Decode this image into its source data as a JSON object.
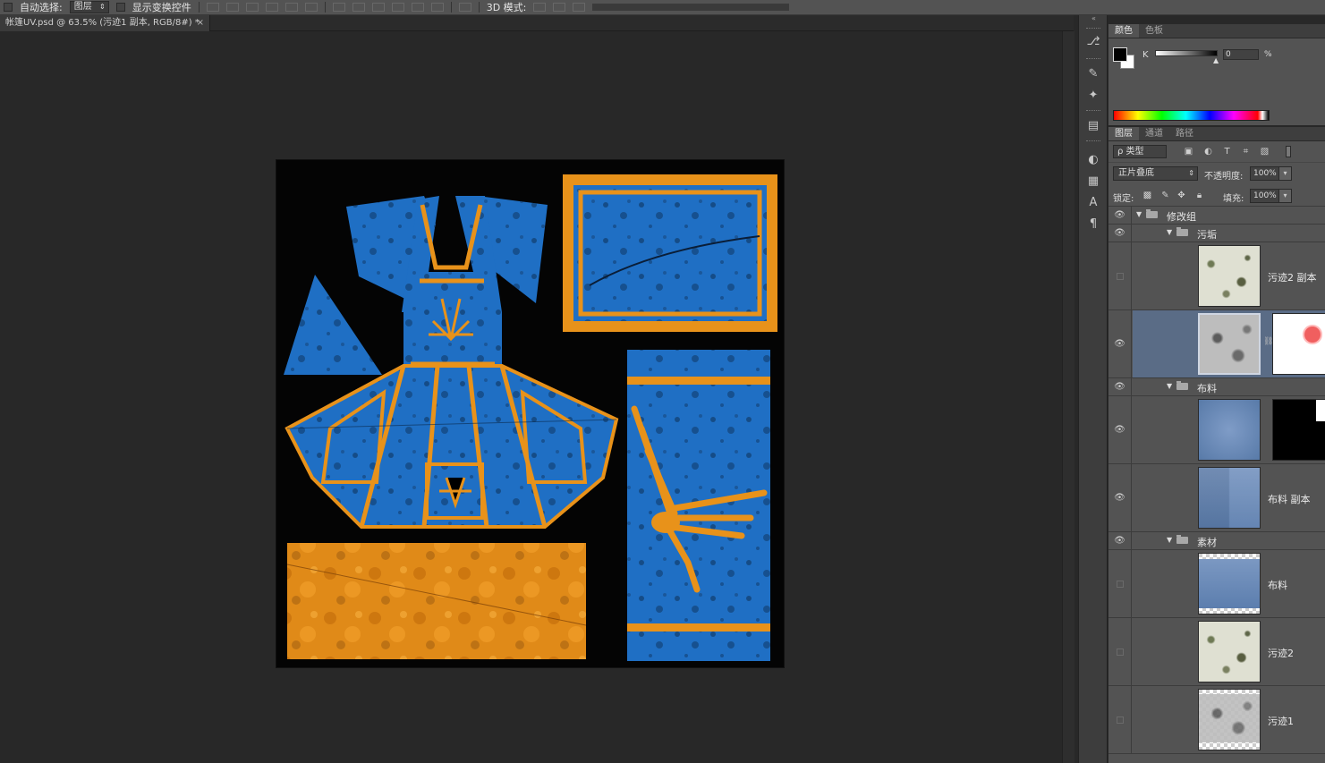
{
  "options_bar": {
    "auto_select_label": "自动选择:",
    "auto_select_value": "图层",
    "show_transform_label": "显示变换控件",
    "mode_3d_label": "3D 模式:"
  },
  "document_tab": {
    "title": "帐篷UV.psd @ 63.5% (污迹1 副本, RGB/8#) *",
    "close": "×"
  },
  "color_panel": {
    "tabs": [
      "颜色",
      "色板"
    ],
    "channel_label": "K",
    "value": "0",
    "unit": "%",
    "foreground": "#000000",
    "background": "#ffffff"
  },
  "layers_panel": {
    "tabs": [
      "图层",
      "通道",
      "路径"
    ],
    "filter_label": "ρ 类型",
    "blend_mode": "正片叠底",
    "opacity_label": "不透明度:",
    "opacity_value": "100%",
    "lock_label": "锁定:",
    "fill_label": "填充:",
    "fill_value": "100%",
    "layers": [
      {
        "kind": "group",
        "name": "修改组",
        "visible": true,
        "indent": 0
      },
      {
        "kind": "group",
        "name": "污垢",
        "visible": true,
        "indent": 1
      },
      {
        "kind": "layer",
        "name": "污迹2 副本",
        "visible": false,
        "thumb": "dirt"
      },
      {
        "kind": "layer",
        "name": "",
        "visible": true,
        "thumb": "dirt1",
        "mask": "white",
        "selected": true
      },
      {
        "kind": "group",
        "name": "布料",
        "visible": true,
        "indent": 1
      },
      {
        "kind": "layer",
        "name": "",
        "visible": true,
        "thumb": "cloth",
        "mask": "black"
      },
      {
        "kind": "layer",
        "name": "布料 副本",
        "visible": true,
        "thumb": "cloth2"
      },
      {
        "kind": "group",
        "name": "素材",
        "visible": true,
        "indent": 1
      },
      {
        "kind": "layer",
        "name": "布料",
        "visible": false,
        "thumb": "cloth-checker"
      },
      {
        "kind": "layer",
        "name": "污迹2",
        "visible": false,
        "thumb": "dirt"
      },
      {
        "kind": "layer",
        "name": "污迹1",
        "visible": false,
        "thumb": "dirt1-checker"
      }
    ]
  },
  "icons": {
    "eye": "eye-icon",
    "folder": "folder-icon",
    "link": "link-icon"
  },
  "colors": {
    "canvas_blue": "#1f6fc4",
    "canvas_orange": "#e8921a",
    "selection": "#5a6c86"
  }
}
